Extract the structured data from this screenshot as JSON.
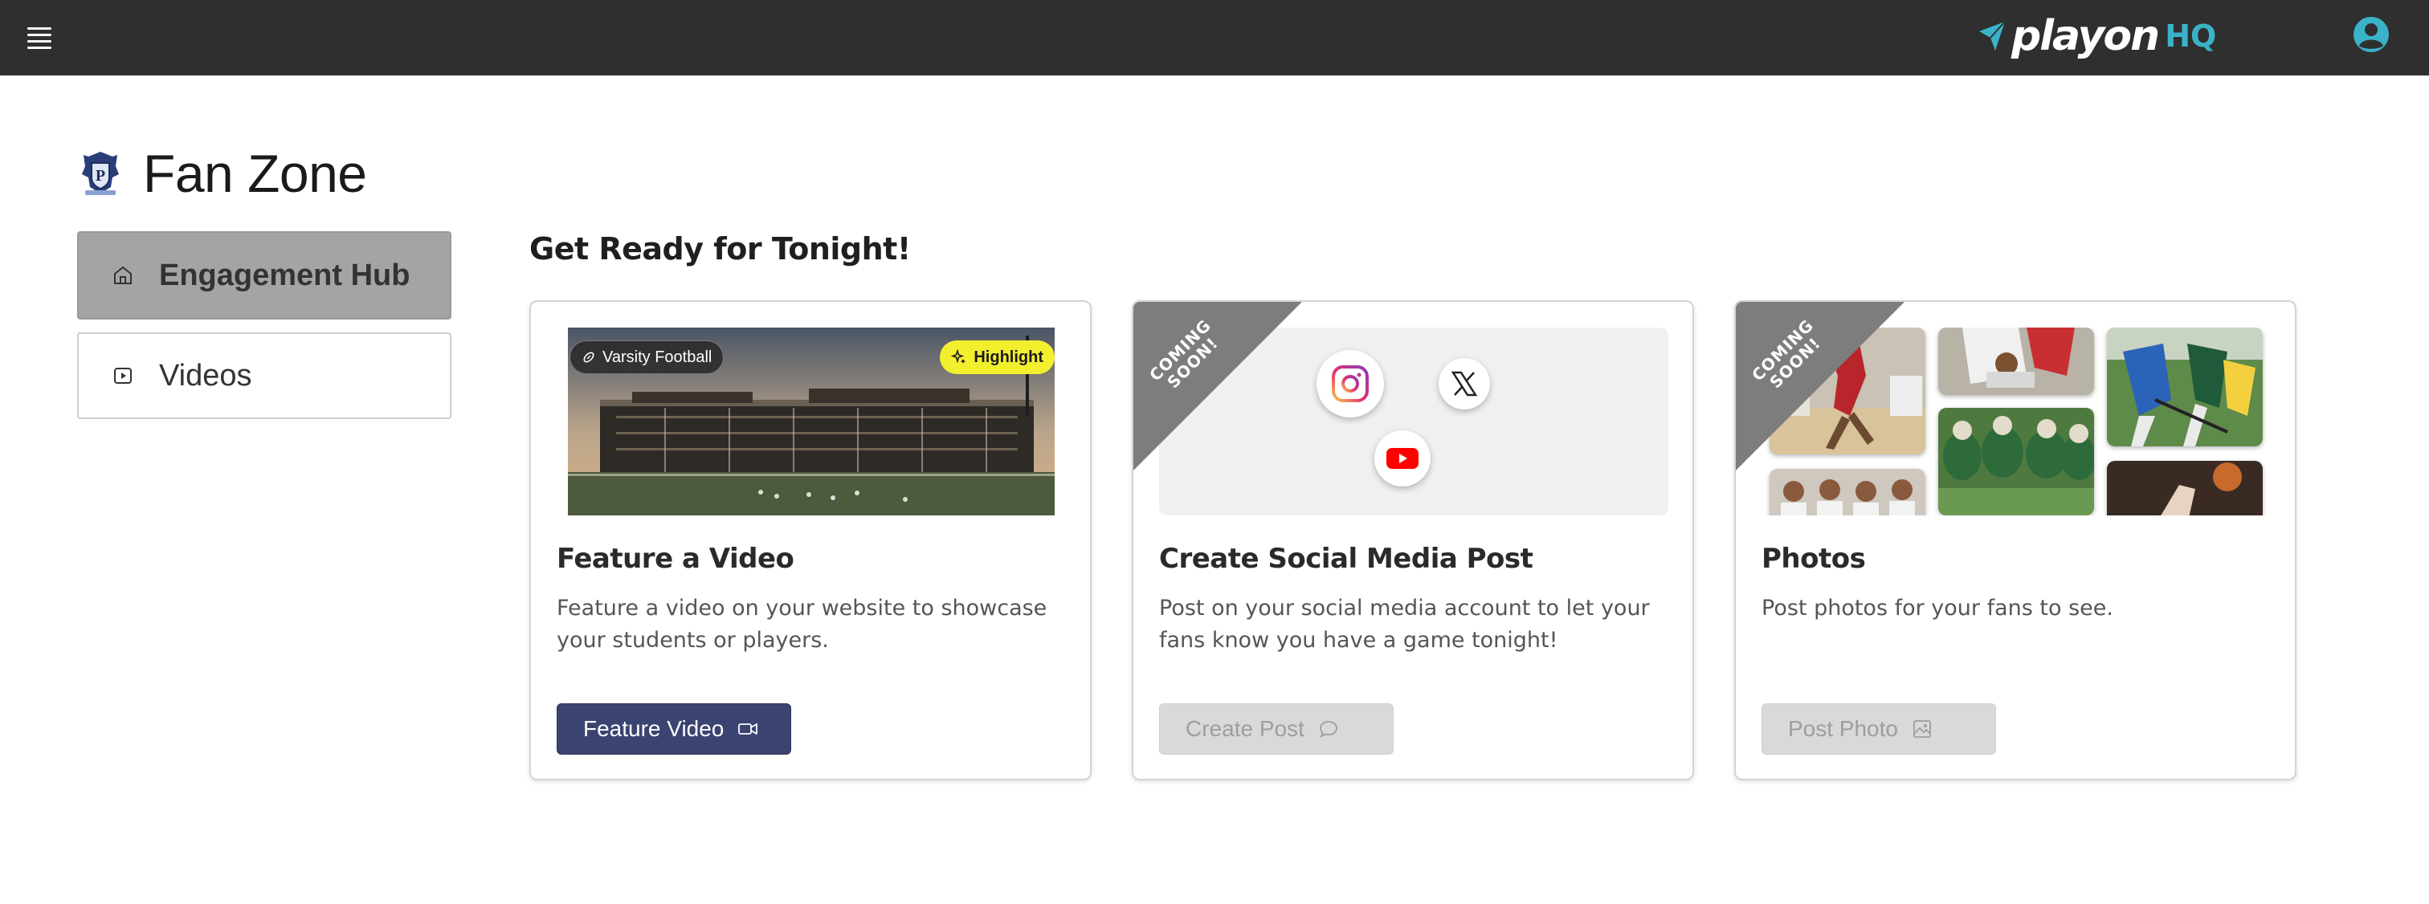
{
  "app": {
    "brand": "playon",
    "brand_suffix": "HQ",
    "brand_color": "#3ab3c9",
    "header_bg": "#2f2f2f"
  },
  "header": {
    "menu_icon": "hamburger-menu-icon",
    "account_icon": "account-circle-icon"
  },
  "page": {
    "title": "Fan Zone",
    "crest_icon": "school-crest-icon"
  },
  "nav": {
    "items": [
      {
        "label": "Engagement Hub",
        "icon": "home-icon",
        "active": true
      },
      {
        "label": "Videos",
        "icon": "play-icon",
        "active": false
      }
    ]
  },
  "section": {
    "title": "Get Ready for Tonight!"
  },
  "cards": [
    {
      "title": "Feature a Video",
      "description": "Feature a video on your website to showcase your students or players.",
      "button": {
        "label": "Feature Video",
        "icon": "video-camera-icon",
        "enabled": true
      },
      "media": {
        "tag": "Varsity Football",
        "tag_icon": "football-icon",
        "badge": "Highlight",
        "badge_icon": "sparkle-icon"
      }
    },
    {
      "title": "Create Social Media Post",
      "description": "Post on your social media account to let your fans know you have a game tonight!",
      "button": {
        "label": "Create Post",
        "icon": "chat-bubble-icon",
        "enabled": false
      },
      "ribbon": "COMING SOON!",
      "media": {
        "icons": [
          "instagram-icon",
          "x-icon",
          "youtube-icon"
        ]
      }
    },
    {
      "title": "Photos",
      "description": "Post photos for your fans to see.",
      "button": {
        "label": "Post Photo",
        "icon": "image-icon",
        "enabled": false
      },
      "ribbon": "COMING SOON!"
    }
  ],
  "colors": {
    "primary_button": "#3b4370",
    "highlight_badge": "#f2ef2e",
    "active_nav": "#a4a4a4",
    "ribbon": "#7d7d7d"
  }
}
